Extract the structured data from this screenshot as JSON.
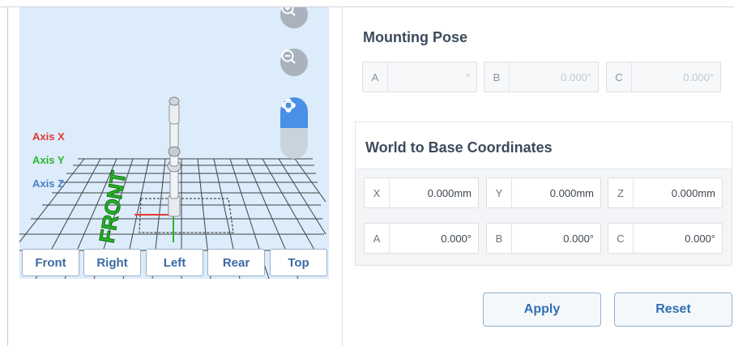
{
  "viewport": {
    "axis_x_label": "Axis X",
    "axis_y_label": "Axis Y",
    "axis_z_label": "Axis Z",
    "floor_text": "FRONT",
    "colors": {
      "axis_x": "#e53935",
      "axis_y": "#2db52d",
      "axis_z": "#4a80c8",
      "accent": "#4a90e8"
    },
    "view_buttons": [
      "Front",
      "Right",
      "Left",
      "Rear",
      "Top"
    ]
  },
  "mounting_pose": {
    "title": "Mounting Pose",
    "fields": [
      {
        "label": "A",
        "value": "°"
      },
      {
        "label": "B",
        "value": "0.000°"
      },
      {
        "label": "C",
        "value": "0.000°"
      }
    ]
  },
  "world_to_base": {
    "title": "World to Base Coordinates",
    "fields": [
      {
        "label": "X",
        "value": "0.000mm"
      },
      {
        "label": "Y",
        "value": "0.000mm"
      },
      {
        "label": "Z",
        "value": "0.000mm"
      },
      {
        "label": "A",
        "value": "0.000°"
      },
      {
        "label": "B",
        "value": "0.000°"
      },
      {
        "label": "C",
        "value": "0.000°"
      }
    ]
  },
  "actions": {
    "apply": "Apply",
    "reset": "Reset"
  }
}
